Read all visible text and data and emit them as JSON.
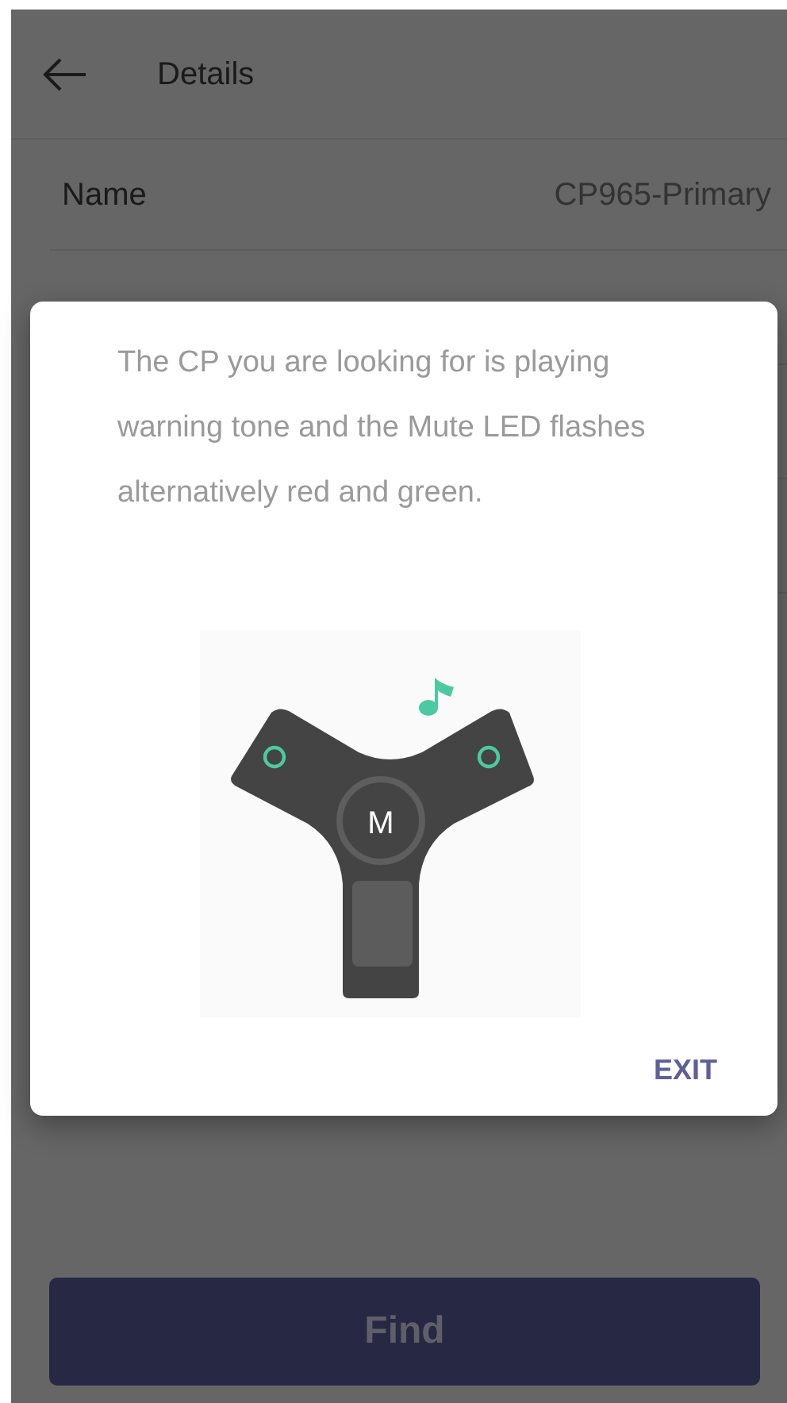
{
  "header": {
    "title": "Details"
  },
  "rows": [
    {
      "label": "Name",
      "value": "CP965-Primary"
    }
  ],
  "dialog": {
    "message": "The CP you are looking for is playing warning tone and the Mute LED flashes alternatively red and green.",
    "key_label": "M",
    "button": "EXIT"
  },
  "find_button": {
    "label": "Find",
    "disabled": true
  }
}
